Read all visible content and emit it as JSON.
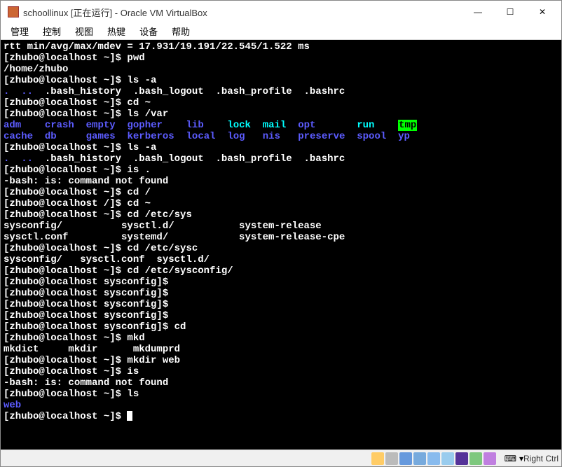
{
  "window": {
    "title": "schoollinux [正在运行] - Oracle VM VirtualBox"
  },
  "menus": [
    "管理",
    "控制",
    "视图",
    "热键",
    "设备",
    "帮助"
  ],
  "terminal_lines": [
    {
      "segs": [
        {
          "t": "rtt min/avg/max/mdev = 17.931/19.191/22.545/1.522 ms"
        }
      ]
    },
    {
      "segs": [
        {
          "t": "[zhubo@localhost ~]$ pwd"
        }
      ]
    },
    {
      "segs": [
        {
          "t": "/home/zhubo"
        }
      ]
    },
    {
      "segs": [
        {
          "t": "[zhubo@localhost ~]$ ls -a"
        }
      ]
    },
    {
      "segs": [
        {
          "t": ".",
          "c": "t-blue"
        },
        {
          "t": "  "
        },
        {
          "t": "..",
          "c": "t-blue"
        },
        {
          "t": "  .bash_history  .bash_logout  .bash_profile  .bashrc"
        }
      ]
    },
    {
      "segs": [
        {
          "t": "[zhubo@localhost ~]$ cd ~"
        }
      ]
    },
    {
      "segs": [
        {
          "t": "[zhubo@localhost ~]$ ls /var"
        }
      ]
    },
    {
      "segs": [
        {
          "t": "adm",
          "c": "t-blue"
        },
        {
          "t": "    "
        },
        {
          "t": "crash",
          "c": "t-blue"
        },
        {
          "t": "  "
        },
        {
          "t": "empty",
          "c": "t-blue"
        },
        {
          "t": "  "
        },
        {
          "t": "gopher",
          "c": "t-blue"
        },
        {
          "t": "    "
        },
        {
          "t": "lib",
          "c": "t-blue"
        },
        {
          "t": "    "
        },
        {
          "t": "lock",
          "c": "t-cyan"
        },
        {
          "t": "  "
        },
        {
          "t": "mail",
          "c": "t-cyan"
        },
        {
          "t": "  "
        },
        {
          "t": "opt",
          "c": "t-blue"
        },
        {
          "t": "       "
        },
        {
          "t": "run",
          "c": "t-cyan"
        },
        {
          "t": "    "
        },
        {
          "t": "tmp",
          "c": "t-green-hl"
        }
      ]
    },
    {
      "segs": [
        {
          "t": "cache",
          "c": "t-blue"
        },
        {
          "t": "  "
        },
        {
          "t": "db",
          "c": "t-blue"
        },
        {
          "t": "     "
        },
        {
          "t": "games",
          "c": "t-blue"
        },
        {
          "t": "  "
        },
        {
          "t": "kerberos",
          "c": "t-blue"
        },
        {
          "t": "  "
        },
        {
          "t": "local",
          "c": "t-blue"
        },
        {
          "t": "  "
        },
        {
          "t": "log",
          "c": "t-blue"
        },
        {
          "t": "   "
        },
        {
          "t": "nis",
          "c": "t-blue"
        },
        {
          "t": "   "
        },
        {
          "t": "preserve",
          "c": "t-blue"
        },
        {
          "t": "  "
        },
        {
          "t": "spool",
          "c": "t-blue"
        },
        {
          "t": "  "
        },
        {
          "t": "yp",
          "c": "t-blue"
        }
      ]
    },
    {
      "segs": [
        {
          "t": "[zhubo@localhost ~]$ ls -a"
        }
      ]
    },
    {
      "segs": [
        {
          "t": ".",
          "c": "t-blue"
        },
        {
          "t": "  "
        },
        {
          "t": "..",
          "c": "t-blue"
        },
        {
          "t": "  .bash_history  .bash_logout  .bash_profile  .bashrc"
        }
      ]
    },
    {
      "segs": [
        {
          "t": "[zhubo@localhost ~]$ is ."
        }
      ]
    },
    {
      "segs": [
        {
          "t": "-bash: is: command not found"
        }
      ]
    },
    {
      "segs": [
        {
          "t": "[zhubo@localhost ~]$ cd /"
        }
      ]
    },
    {
      "segs": [
        {
          "t": "[zhubo@localhost /]$ cd ~"
        }
      ]
    },
    {
      "segs": [
        {
          "t": "[zhubo@localhost ~]$ cd /etc/sys"
        }
      ]
    },
    {
      "segs": [
        {
          "t": "sysconfig/          sysctl.d/           system-release"
        }
      ]
    },
    {
      "segs": [
        {
          "t": "sysctl.conf         systemd/            system-release-cpe"
        }
      ]
    },
    {
      "segs": [
        {
          "t": "[zhubo@localhost ~]$ cd /etc/sysc"
        }
      ]
    },
    {
      "segs": [
        {
          "t": "sysconfig/   sysctl.conf  sysctl.d/"
        }
      ]
    },
    {
      "segs": [
        {
          "t": "[zhubo@localhost ~]$ cd /etc/sysconfig/"
        }
      ]
    },
    {
      "segs": [
        {
          "t": "[zhubo@localhost sysconfig]$"
        }
      ]
    },
    {
      "segs": [
        {
          "t": "[zhubo@localhost sysconfig]$"
        }
      ]
    },
    {
      "segs": [
        {
          "t": "[zhubo@localhost sysconfig]$"
        }
      ]
    },
    {
      "segs": [
        {
          "t": "[zhubo@localhost sysconfig]$"
        }
      ]
    },
    {
      "segs": [
        {
          "t": "[zhubo@localhost sysconfig]$ cd"
        }
      ]
    },
    {
      "segs": [
        {
          "t": "[zhubo@localhost ~]$ mkd"
        }
      ]
    },
    {
      "segs": [
        {
          "t": "mkdict     mkdir      mkdumprd"
        }
      ]
    },
    {
      "segs": [
        {
          "t": "[zhubo@localhost ~]$ mkdir web"
        }
      ]
    },
    {
      "segs": [
        {
          "t": "[zhubo@localhost ~]$ is"
        }
      ]
    },
    {
      "segs": [
        {
          "t": "-bash: is: command not found"
        }
      ]
    },
    {
      "segs": [
        {
          "t": "[zhubo@localhost ~]$ ls"
        }
      ]
    },
    {
      "segs": [
        {
          "t": "web",
          "c": "t-blue"
        }
      ]
    },
    {
      "segs": [
        {
          "t": "[zhubo@localhost ~]$ "
        }
      ],
      "cursor": true
    }
  ],
  "statusbar": {
    "host_key": "Right Ctrl",
    "key_icon": "⌨"
  }
}
